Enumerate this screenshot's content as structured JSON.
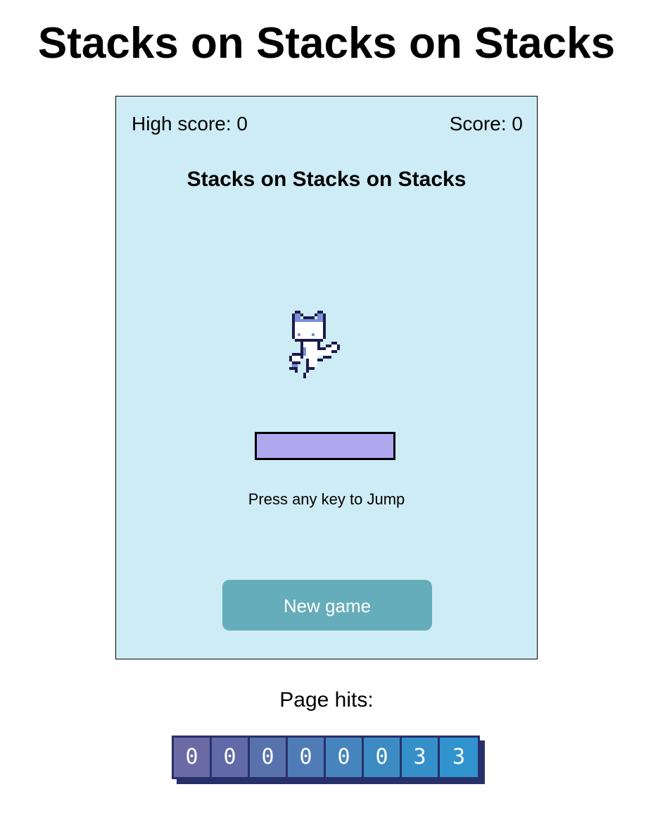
{
  "page": {
    "title": "Stacks on Stacks on Stacks"
  },
  "game": {
    "high_score_label": "High score: 0",
    "score_label": "Score: 0",
    "title": "Stacks on Stacks on Stacks",
    "character_icon": "pixel-cat-kicking",
    "instructions": "Press any key to Jump",
    "new_game_label": "New game",
    "colors": {
      "background": "#ceecf5",
      "platform": "#b0a8ee",
      "button": "#66adbc"
    }
  },
  "hits": {
    "label": "Page hits:",
    "digits": [
      "0",
      "0",
      "0",
      "0",
      "0",
      "0",
      "3",
      "3"
    ],
    "digit_colors": [
      "#6a6aa4",
      "#6269a8",
      "#5872ad",
      "#4f7cb6",
      "#4584bd",
      "#3c8cc3",
      "#3590ca",
      "#3093cd"
    ]
  }
}
